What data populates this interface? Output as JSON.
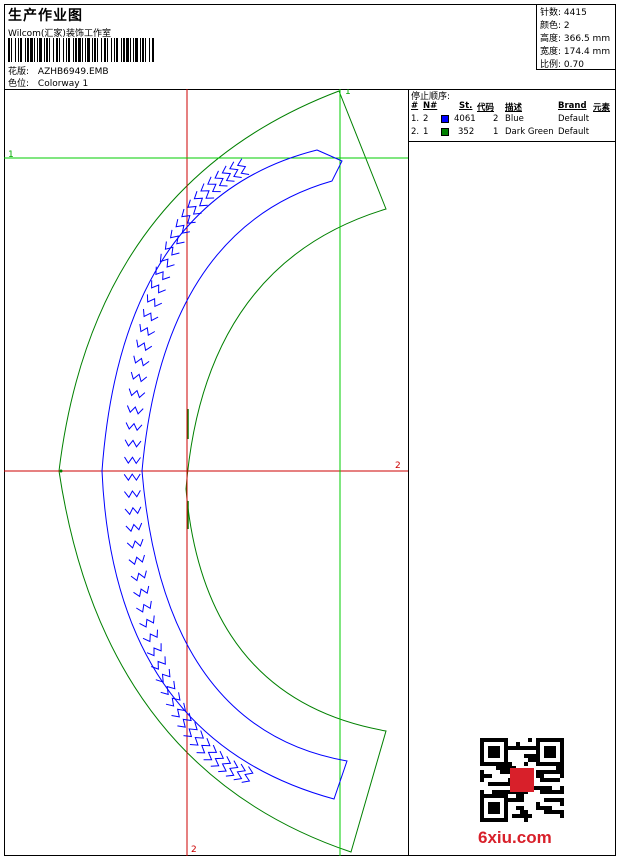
{
  "header": {
    "title": "生产作业图",
    "company": "Wilcom(汇家)装饰工作室",
    "design_label": "花版:",
    "design_value": "AZHB6949.EMB",
    "colorway_label": "色位:",
    "colorway_value": "Colorway 1"
  },
  "stats": [
    {
      "label": "针数:",
      "value": "4415"
    },
    {
      "label": "颜色:",
      "value": "2"
    },
    {
      "label": "高度:",
      "value": "366.5 mm"
    },
    {
      "label": "宽度:",
      "value": "174.4 mm"
    },
    {
      "label": "比例:",
      "value": "0.70"
    }
  ],
  "stop_sequence": {
    "title": "停止顺序:",
    "columns": [
      "#",
      "N#",
      "St.",
      "代码",
      "描述",
      "Brand",
      "元素"
    ],
    "rows": [
      {
        "index": "1.",
        "needle": "2",
        "stitches": "4061",
        "code": "2",
        "description": "Blue",
        "brand": "Default",
        "color": "#0000ff"
      },
      {
        "index": "2.",
        "needle": "1",
        "stitches": "352",
        "code": "1",
        "description": "Dark Green",
        "brand": "Default",
        "color": "#008000"
      }
    ]
  },
  "axis_labels": {
    "vertical_top": "1",
    "horizontal_left": "1",
    "horizontal_right": "2",
    "vertical_bottom": "2"
  },
  "colors": {
    "red_axis": "#cc0000",
    "green_axis": "#00cc00",
    "outline": "#008000",
    "stitch": "#0000ff"
  },
  "watermark": {
    "text": "6xiu.com"
  }
}
